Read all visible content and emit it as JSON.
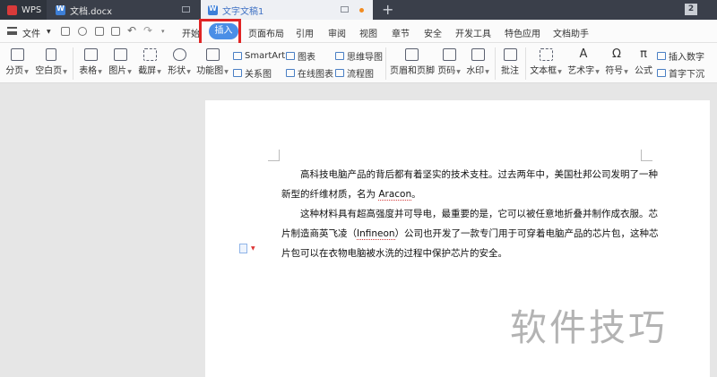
{
  "tabs": {
    "wps": "WPS",
    "doc1": "文档.docx",
    "doc2": "文字文稿1",
    "new_tab": "+",
    "window_count": "2"
  },
  "menu": {
    "file": "文件",
    "items": [
      "开始",
      "插入",
      "页面布局",
      "引用",
      "审阅",
      "视图",
      "章节",
      "安全",
      "开发工具",
      "特色应用",
      "文档助手"
    ],
    "active": "插入"
  },
  "ribbon": {
    "page_break": "分页",
    "blank_page": "空白页",
    "table": "表格",
    "picture": "图片",
    "screenshot": "截屏",
    "shape": "形状",
    "func_chart": "功能图",
    "smartart": "SmartArt",
    "chart": "图表",
    "mindmap": "思维导图",
    "relation": "关系图",
    "online_chart": "在线图表",
    "flowchart": "流程图",
    "header_footer": "页眉和页脚",
    "page_number": "页码",
    "watermark": "水印",
    "comment": "批注",
    "textbox": "文本框",
    "wordart": "艺术字",
    "symbol": "符号",
    "formula": "公式",
    "insert_number": "插入数字",
    "drop_cap": "首字下沉"
  },
  "document": {
    "p1_line1": "高科技电脑产品的背后都有着坚实的技术支柱。过去两年中，美国杜邦公司发明了一种",
    "p1_line2_a": "新型的纤维材质，名为 ",
    "p1_line2_b": "Aracon",
    "p1_line2_c": "。",
    "p2_line1": "这种材料具有超高强度并可导电，最重要的是，它可以被任意地折叠并制作成衣服。芯",
    "p2_line2_a": "片制造商英飞凌（",
    "p2_line2_b": "Infineon",
    "p2_line2_c": "）公司也开发了一款专门用于可穿着电脑产品的芯片包，这种芯",
    "p2_line3": "片包可以在衣物电脑被水洗的过程中保护芯片的安全。"
  },
  "watermark_text": "软件技巧"
}
